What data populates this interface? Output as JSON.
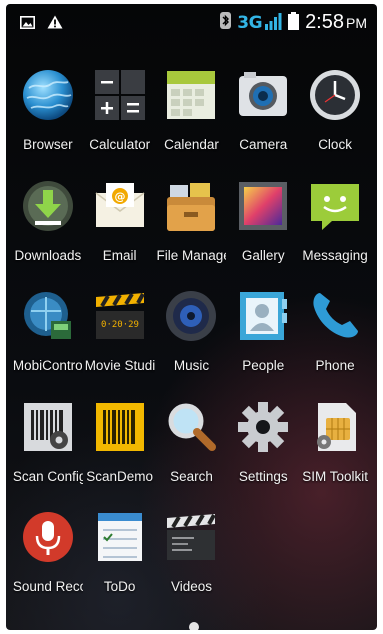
{
  "status_bar": {
    "left_icons": [
      "image-notification-icon",
      "warning-icon"
    ],
    "bluetooth_icon": "bluetooth-icon",
    "network": "3G",
    "signal_icon": "signal-icon",
    "battery_icon": "battery-icon",
    "time": "2:58",
    "ampm": "PM"
  },
  "apps": [
    {
      "label": "Browser",
      "icon": "browser-icon"
    },
    {
      "label": "Calculator",
      "icon": "calculator-icon"
    },
    {
      "label": "Calendar",
      "icon": "calendar-icon"
    },
    {
      "label": "Camera",
      "icon": "camera-icon"
    },
    {
      "label": "Clock",
      "icon": "clock-icon"
    },
    {
      "label": "Downloads",
      "icon": "downloads-icon"
    },
    {
      "label": "Email",
      "icon": "email-icon"
    },
    {
      "label": "File Manage",
      "icon": "file-manager-icon"
    },
    {
      "label": "Gallery",
      "icon": "gallery-icon"
    },
    {
      "label": "Messaging",
      "icon": "messaging-icon"
    },
    {
      "label": "MobiControl",
      "icon": "mobicontrol-icon"
    },
    {
      "label": "Movie Studio",
      "icon": "movie-studio-icon"
    },
    {
      "label": "Music",
      "icon": "music-icon"
    },
    {
      "label": "People",
      "icon": "people-icon"
    },
    {
      "label": "Phone",
      "icon": "phone-icon"
    },
    {
      "label": "Scan Config",
      "icon": "scan-config-icon"
    },
    {
      "label": "ScanDemo",
      "icon": "scan-demo-icon"
    },
    {
      "label": "Search",
      "icon": "search-icon"
    },
    {
      "label": "Settings",
      "icon": "settings-icon"
    },
    {
      "label": "SIM Toolkit",
      "icon": "sim-toolkit-icon"
    },
    {
      "label": "Sound Reco",
      "icon": "sound-recorder-icon"
    },
    {
      "label": "ToDo",
      "icon": "todo-icon"
    },
    {
      "label": "Videos",
      "icon": "videos-icon"
    }
  ],
  "colors": {
    "network_accent": "#33b5e5",
    "background": "#0a0c10"
  }
}
